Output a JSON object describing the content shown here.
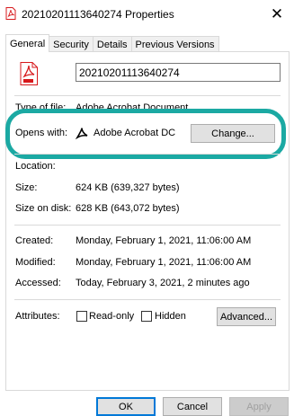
{
  "window": {
    "title": "20210201113640274 Properties",
    "close_glyph": "✕"
  },
  "tabs": [
    {
      "label": "General",
      "active": true
    },
    {
      "label": "Security",
      "active": false
    },
    {
      "label": "Details",
      "active": false
    },
    {
      "label": "Previous Versions",
      "active": false
    }
  ],
  "general": {
    "file_name": "20210201113640274",
    "type_label": "Type of file:",
    "type_value": "Adobe Acrobat Document (.pdf)",
    "opens_with_label": "Opens with:",
    "opens_with_app": "Adobe Acrobat DC",
    "change_button": "Change...",
    "location_label": "Location:",
    "location_value": "",
    "size_label": "Size:",
    "size_value": "624 KB (639,327 bytes)",
    "size_on_disk_label": "Size on disk:",
    "size_on_disk_value": "628 KB (643,072 bytes)",
    "created_label": "Created:",
    "created_value": "Monday, February 1, 2021, 11:06:00 AM",
    "modified_label": "Modified:",
    "modified_value": "Monday, February 1, 2021, 11:06:00 AM",
    "accessed_label": "Accessed:",
    "accessed_value": "Today, February 3, 2021, 2 minutes ago",
    "attributes_label": "Attributes:",
    "readonly_label": "Read-only",
    "readonly_checked": false,
    "hidden_label": "Hidden",
    "hidden_checked": false,
    "advanced_button": "Advanced..."
  },
  "footer": {
    "ok": "OK",
    "cancel": "Cancel",
    "apply": "Apply"
  },
  "colors": {
    "highlight": "#1ba9a3",
    "pdf_red": "#d7191c"
  },
  "icons": {
    "title": "pdf-file-icon",
    "file": "pdf-file-icon",
    "app": "adobe-acrobat-icon"
  }
}
